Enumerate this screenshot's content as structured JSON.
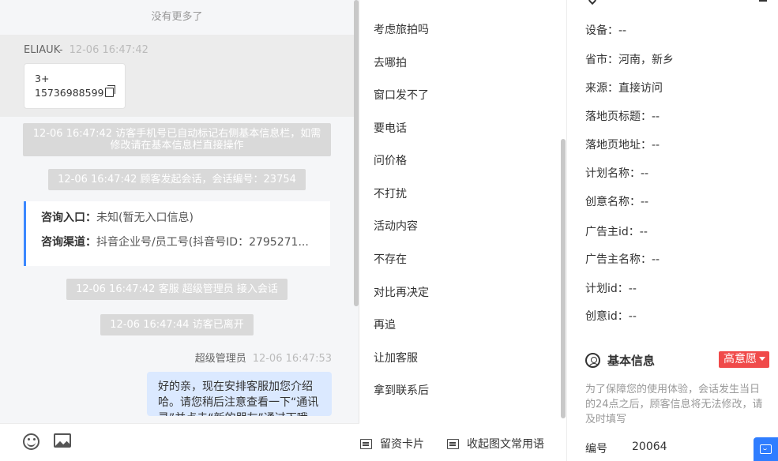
{
  "chat": {
    "no_more": "没有更多了",
    "visitor": {
      "name": "ELIAUK-",
      "time": "12-06 16:47:42",
      "msg_line1": "3+",
      "msg_line2": "15736988599"
    },
    "sys_phone": "12-06 16:47:42 访客手机号已自动标记右侧基本信息栏，如需修改请在基本信息栏直接操作",
    "sys_session": "12-06 16:47:42 顾客发起会话，会话编号：23754",
    "card": {
      "entry_label": "咨询入口：",
      "entry_value": "未知(暂无入口信息)",
      "channel_label": "咨询渠道：",
      "channel_value": "抖音企业号/员工号(抖音号ID：2795271..."
    },
    "sys_agent_join": "12-06 16:47:42 客服 超级管理员 接入会话",
    "sys_visitor_left": "12-06 16:47:44 访客已离开",
    "agent": {
      "name": "超级管理员",
      "time": "12-06 16:47:53",
      "message": "好的亲，现在安排客服加您介绍哈。请您稍后注意查看一下“通讯录”并点击“新的朋友”通过下哦"
    }
  },
  "phrases": {
    "items": [
      "考虑旅拍吗",
      "去哪拍",
      "窗口发不了",
      "要电话",
      "问价格",
      "不打扰",
      "活动内容",
      "不存在",
      "对比再决定",
      "再追",
      "让加客服",
      "拿到联系后"
    ],
    "footer_card": "留资卡片",
    "footer_collapse": "收起图文常用语"
  },
  "info": {
    "rows": [
      {
        "label": "设备：",
        "value": "--"
      },
      {
        "label": "省市：",
        "value": "河南，新乡"
      },
      {
        "label": "来源：",
        "value": "直接访问"
      },
      {
        "label": "落地页标题：",
        "value": "--"
      },
      {
        "label": "落地页地址：",
        "value": "--"
      },
      {
        "label": "计划名称：",
        "value": "--"
      },
      {
        "label": "创意名称：",
        "value": "--"
      },
      {
        "label": "广告主id：",
        "value": "--"
      },
      {
        "label": "广告主名称：",
        "value": "--"
      },
      {
        "label": "计划id：",
        "value": "--"
      },
      {
        "label": "创意id：",
        "value": "--"
      }
    ],
    "basic_title": "基本信息",
    "intent_badge": "高意愿",
    "hint": "为了保障您的使用体验，会话发生当日的24点之后，顾客信息将无法修改，请及时填写",
    "id_label": "编号",
    "id_value": "20064"
  },
  "colors": {
    "accent": "#3b88ff",
    "badge": "#f04a4a",
    "agent_bubble": "#dbe9ff",
    "system_msg": "#d9d9d9"
  }
}
